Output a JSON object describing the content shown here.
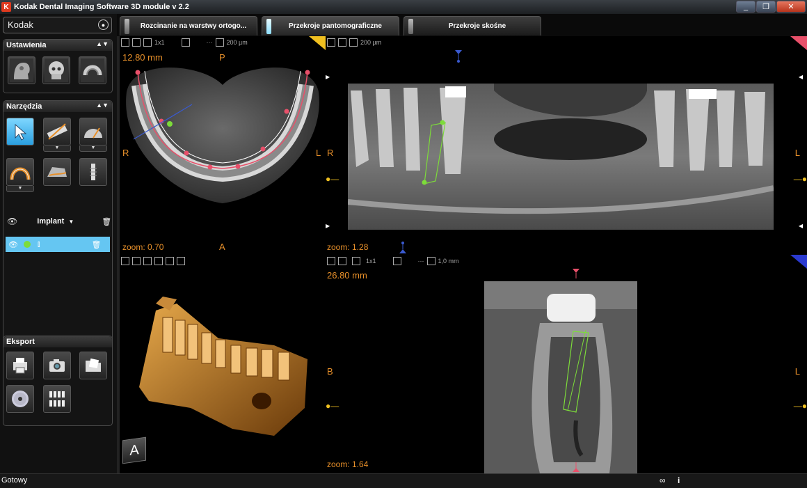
{
  "window": {
    "title": "Kodak Dental Imaging Software 3D module v 2.2",
    "logo": "K",
    "buttons": [
      "_",
      "❐",
      "✕"
    ]
  },
  "sidebar": {
    "search_value": "Kodak",
    "settings_title": "Ustawienia",
    "tools_title": "Narzędzia",
    "export_title": "Eksport",
    "implant_label": "Implant"
  },
  "tabs": [
    {
      "label": "Rozcinanie na warstwy ortogo...",
      "active": false
    },
    {
      "label": "Przekroje pantomograficzne",
      "active": true
    },
    {
      "label": "Przekroje skośne",
      "active": false
    }
  ],
  "views": {
    "axial": {
      "toolbar_grid": "1x1",
      "toolbar_res": "200 µm",
      "thickness": "12.80 mm",
      "label_top": "P",
      "label_left": "R",
      "label_right": "L",
      "label_bottom": "A",
      "zoom": "zoom: 0.70"
    },
    "panoramic": {
      "toolbar_res": "200 µm",
      "label_left": "R",
      "label_right": "L",
      "zoom": "zoom: 1.28"
    },
    "volume": {
      "cube_label": "A"
    },
    "cross": {
      "toolbar_grid": "1x1",
      "toolbar_res": "1,0 mm",
      "thickness": "26.80 mm",
      "label_left": "B",
      "label_right": "L",
      "zoom": "zoom: 1.64"
    }
  },
  "status": {
    "text": "Gotowy",
    "icons": [
      "∞",
      "i"
    ]
  },
  "colors": {
    "accent_orange": "#e8902a",
    "active_tab": "#8ee0ff",
    "selected_row": "#65c6f2",
    "corner_yellow": "#f0c020",
    "corner_pink": "#e8506a",
    "corner_blue": "#2a3ad0"
  }
}
